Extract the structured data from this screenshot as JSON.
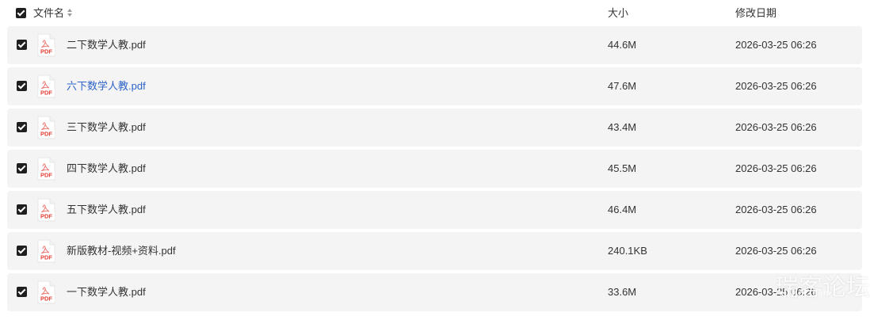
{
  "header": {
    "name_label": "文件名",
    "size_label": "大小",
    "date_label": "修改日期"
  },
  "files": [
    {
      "name": "二下数学人教.pdf",
      "size": "44.6M",
      "date": "2026-03-25 06:26",
      "checked": true,
      "link": false
    },
    {
      "name": "六下数学人教.pdf",
      "size": "47.6M",
      "date": "2026-03-25 06:26",
      "checked": true,
      "link": true
    },
    {
      "name": "三下数学人教.pdf",
      "size": "43.4M",
      "date": "2026-03-25 06:26",
      "checked": true,
      "link": false
    },
    {
      "name": "四下数学人教.pdf",
      "size": "45.5M",
      "date": "2026-03-25 06:26",
      "checked": true,
      "link": false
    },
    {
      "name": "五下数学人教.pdf",
      "size": "46.4M",
      "date": "2026-03-25 06:26",
      "checked": true,
      "link": false
    },
    {
      "name": "新版教材-视频+资料.pdf",
      "size": "240.1KB",
      "date": "2026-03-25 06:26",
      "checked": true,
      "link": false
    },
    {
      "name": "一下数学人教.pdf",
      "size": "33.6M",
      "date": "2026-03-25 06:26",
      "checked": true,
      "link": false
    }
  ],
  "file_icon": {
    "name": "pdf-icon",
    "label": "PDF",
    "color": "#e5413a"
  },
  "accent_link_color": "#2d63c8",
  "watermark": {
    "text": "瑞客论坛",
    "sub": "ruike1.com"
  }
}
